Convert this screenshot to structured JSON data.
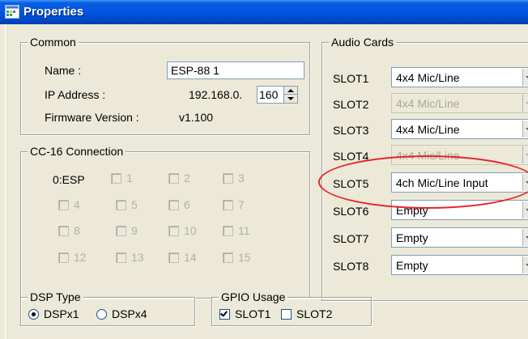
{
  "window": {
    "title": "Properties"
  },
  "common": {
    "title": "Common",
    "name_label": "Name :",
    "name_value": "ESP-88 1",
    "ip_label": "IP Address :",
    "ip_prefix": "192.168.0.",
    "ip_last_octet": "160",
    "firmware_label": "Firmware Version :",
    "firmware_value": "v1.100"
  },
  "cc16": {
    "title": "CC-16 Connection",
    "esp_label": "0:ESP",
    "ports": [
      "1",
      "2",
      "3",
      "4",
      "5",
      "6",
      "7",
      "8",
      "9",
      "10",
      "11",
      "12",
      "13",
      "14",
      "15"
    ]
  },
  "audio_cards": {
    "title": "Audio Cards",
    "slots": [
      {
        "label": "SLOT1",
        "value": "4x4 Mic/Line",
        "enabled": true
      },
      {
        "label": "SLOT2",
        "value": "4x4 Mic/Line",
        "enabled": false
      },
      {
        "label": "SLOT3",
        "value": "4x4 Mic/Line",
        "enabled": true
      },
      {
        "label": "SLOT4",
        "value": "4x4 Mic/Line",
        "enabled": false
      },
      {
        "label": "SLOT5",
        "value": "4ch Mic/Line Input",
        "enabled": true
      },
      {
        "label": "SLOT6",
        "value": "Empty",
        "enabled": true
      },
      {
        "label": "SLOT7",
        "value": "Empty",
        "enabled": true
      },
      {
        "label": "SLOT8",
        "value": "Empty",
        "enabled": true
      }
    ]
  },
  "dsp_type": {
    "title": "DSP Type",
    "options": [
      {
        "label": "DSPx1",
        "selected": true
      },
      {
        "label": "DSPx4",
        "selected": false
      }
    ]
  },
  "gpio_usage": {
    "title": "GPIO Usage",
    "options": [
      {
        "label": "SLOT1",
        "checked": true
      },
      {
        "label": "SLOT2",
        "checked": false
      }
    ]
  },
  "colors": {
    "titlebar": "#0054e3",
    "window_bg": "#ece9d8",
    "annotation": "#e8232c"
  }
}
